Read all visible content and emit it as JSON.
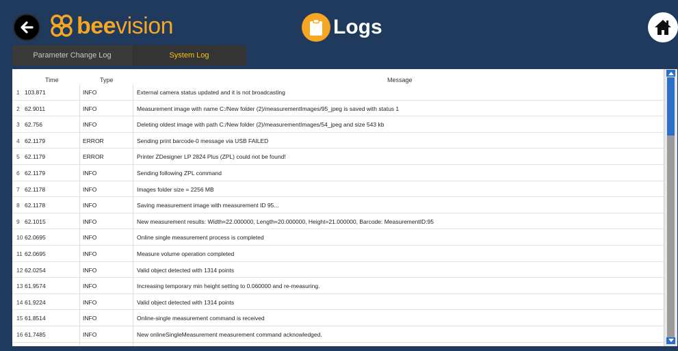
{
  "header": {
    "logo_bold": "bee",
    "logo_thin": "vision",
    "title": "Logs",
    "back_icon": "arrow-left-icon",
    "home_icon": "home-icon",
    "title_icon": "clipboard-icon"
  },
  "tabs": [
    {
      "label": "Parameter Change Log",
      "active": false
    },
    {
      "label": "System Log",
      "active": true
    }
  ],
  "table": {
    "columns": {
      "time": "Time",
      "type": "Type",
      "message": "Message"
    },
    "rows": [
      {
        "idx": "1",
        "time": "103.871",
        "type": "INFO",
        "message": "External camera status updated and it is not broadcasting"
      },
      {
        "idx": "2",
        "time": "62.9011",
        "type": "INFO",
        "message": "Measurement image with name C:/New folder (2)/measurementImages/95_jpeg is saved with status 1"
      },
      {
        "idx": "3",
        "time": "62.756",
        "type": "INFO",
        "message": "Deleting oldest image with path C:/New folder (2)/measurementImages/54_jpeg and size 543 kb"
      },
      {
        "idx": "4",
        "time": "62.1179",
        "type": "ERROR",
        "message": "Sending print barcode-0 message via USB FAILED"
      },
      {
        "idx": "5",
        "time": "62.1179",
        "type": "ERROR",
        "message": "Printer ZDesigner LP 2824 Plus (ZPL) could not be found!"
      },
      {
        "idx": "6",
        "time": "62.1179",
        "type": "INFO",
        "message": "Sending following ZPL command"
      },
      {
        "idx": "7",
        "time": "62.1178",
        "type": "INFO",
        "message": "Images folder size = 2256 MB"
      },
      {
        "idx": "8",
        "time": "62.1178",
        "type": "INFO",
        "message": "Saving measurement image with measurement ID 95..."
      },
      {
        "idx": "9",
        "time": "62.1015",
        "type": "INFO",
        "message": "New measurement results: Width=22.000000, Length=20.000000, Height=21.000000, Barcode: MeasurementID:95"
      },
      {
        "idx": "10",
        "time": "62.0695",
        "type": "INFO",
        "message": "Online single measurement process is completed"
      },
      {
        "idx": "11",
        "time": "62.0695",
        "type": "INFO",
        "message": "Measure volume operation completed"
      },
      {
        "idx": "12",
        "time": "62.0254",
        "type": "INFO",
        "message": "Valid object detected with 1314 points"
      },
      {
        "idx": "13",
        "time": "61.9574",
        "type": "INFO",
        "message": "Increasing temporary min height setting to 0.060000 and re-measuring."
      },
      {
        "idx": "14",
        "time": "61.9224",
        "type": "INFO",
        "message": "Valid object detected with 1314 points"
      },
      {
        "idx": "15",
        "time": "61.8514",
        "type": "INFO",
        "message": "Online-single measurement command is received"
      },
      {
        "idx": "16",
        "time": "61.7485",
        "type": "INFO",
        "message": "New onlineSingleMeasurement measurement command acknowledged."
      }
    ]
  },
  "colors": {
    "background": "#1f3a5c",
    "accent": "#f5a623",
    "active_tab": "#f5c518",
    "scroll_thumb": "#2a6fc9"
  }
}
